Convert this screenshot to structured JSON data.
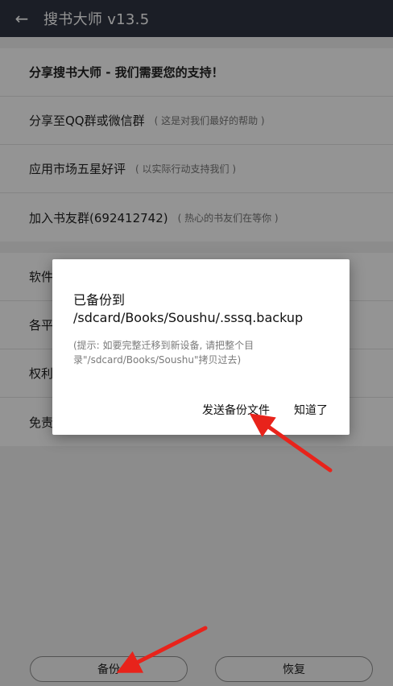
{
  "app_bar": {
    "title": "搜书大师 v13.5"
  },
  "share_section": {
    "header": "分享搜书大师 - 我们需要您的支持！",
    "items": [
      {
        "label": "分享至QQ群或微信群",
        "hint": "( 这是对我们最好的帮助 )"
      },
      {
        "label": "应用市场五星好评",
        "hint": "( 以实际行动支持我们 )"
      },
      {
        "label": "加入书友群(692412742)",
        "hint": "( 热心的书友们在等你 )"
      }
    ]
  },
  "info_section": {
    "items": [
      {
        "label": "软件"
      },
      {
        "label": "各平"
      },
      {
        "label": "权利"
      },
      {
        "label": "免责"
      }
    ]
  },
  "bottom_buttons": {
    "backup": "备份",
    "restore": "恢复"
  },
  "dialog": {
    "title": "已备份到 /sdcard/Books/Soushu/.sssq.backup",
    "hint": "(提示: 如要完整迁移到新设备, 请把整个目录\"/sdcard/Books/Soushu\"拷贝过去)",
    "send_button": "发送备份文件",
    "ok_button": "知道了"
  },
  "colors": {
    "app_bar": "#2f3542",
    "annotation_arrow": "#e8231b"
  }
}
